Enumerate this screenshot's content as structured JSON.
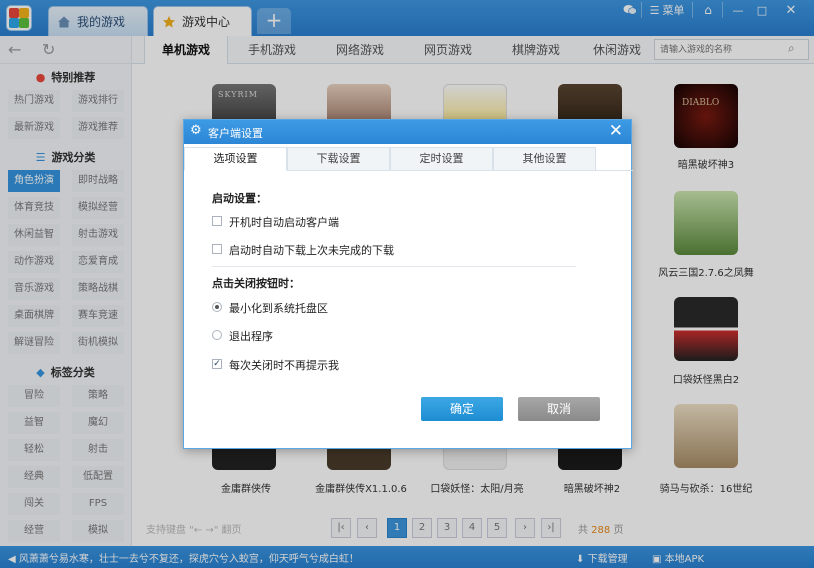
{
  "titlebar": {
    "tabs": [
      {
        "label": "我的游戏"
      },
      {
        "label": "游戏中心"
      }
    ],
    "add_tab": "+",
    "menu_label": "菜单"
  },
  "sidebar": {
    "sections": [
      {
        "title": "特别推荐",
        "icon": "fire-icon",
        "items": [
          "热门游戏",
          "游戏排行",
          "最新游戏",
          "游戏推荐"
        ]
      },
      {
        "title": "游戏分类",
        "icon": "list-icon",
        "items": [
          "角色扮演",
          "即时战略",
          "体育竞技",
          "模拟经营",
          "休闲益智",
          "射击游戏",
          "动作游戏",
          "恋爱育成",
          "音乐游戏",
          "策略战棋",
          "桌面棋牌",
          "赛车竞速",
          "解谜冒险",
          "街机模拟"
        ],
        "selected": 0
      },
      {
        "title": "标签分类",
        "icon": "tag-icon",
        "items": [
          "冒险",
          "策略",
          "益智",
          "魔幻",
          "轻松",
          "射击",
          "经典",
          "低配置",
          "闯关",
          "FPS",
          "经营",
          "模拟"
        ]
      }
    ]
  },
  "topnav": {
    "tabs": [
      "单机游戏",
      "手机游戏",
      "网络游戏",
      "网页游戏",
      "棋牌游戏",
      "休闲游戏"
    ],
    "active": 0,
    "search_placeholder": "请输入游戏的名称"
  },
  "games": [
    {
      "name": "暗黑破坏神3"
    },
    {
      "name": "风云三国2.7.6之凤舞"
    },
    {
      "name": "口袋妖怪黑白2"
    },
    {
      "name": "骑马与砍杀：16世纪"
    },
    {
      "name": "金庸群侠传"
    },
    {
      "name": "金庸群侠传X1.1.0.6"
    },
    {
      "name": "口袋妖怪：太阳/月亮"
    },
    {
      "name": "暗黑破坏神2"
    }
  ],
  "cover_text": {
    "skyrim": "SKYRIM",
    "diablo": "DIABLO"
  },
  "pager": {
    "hint": "支持键盘 \"← →\" 翻页",
    "pages": [
      "1",
      "2",
      "3",
      "4",
      "5"
    ],
    "current": "1",
    "total_prefix": "共",
    "total": "288",
    "total_suffix": "页"
  },
  "bottombar": {
    "marquee": "风萧萧兮易水寒，壮士一去兮不复还，探虎穴兮入蛟宫，仰天呼气兮成白虹！",
    "download_manager": "下载管理",
    "local_apk": "本地APK"
  },
  "dialog": {
    "title": "客户端设置",
    "tabs": [
      "选项设置",
      "下载设置",
      "定时设置",
      "其他设置"
    ],
    "active_tab": 0,
    "startup_heading": "启动设置：",
    "startup_options": [
      {
        "label": "开机时自动启动客户端",
        "checked": false
      },
      {
        "label": "启动时自动下载上次未完成的下载",
        "checked": false
      }
    ],
    "close_heading": "点击关闭按钮时：",
    "close_options": [
      {
        "label": "最小化到系统托盘区",
        "selected": true
      },
      {
        "label": "退出程序",
        "selected": false
      }
    ],
    "no_prompt": {
      "label": "每次关闭时不再提示我",
      "checked": true
    },
    "ok_label": "确定",
    "cancel_label": "取消"
  },
  "colors": {
    "accent": "#2c86d6",
    "selected": "#3595e0",
    "total_number": "#e88a1a"
  }
}
